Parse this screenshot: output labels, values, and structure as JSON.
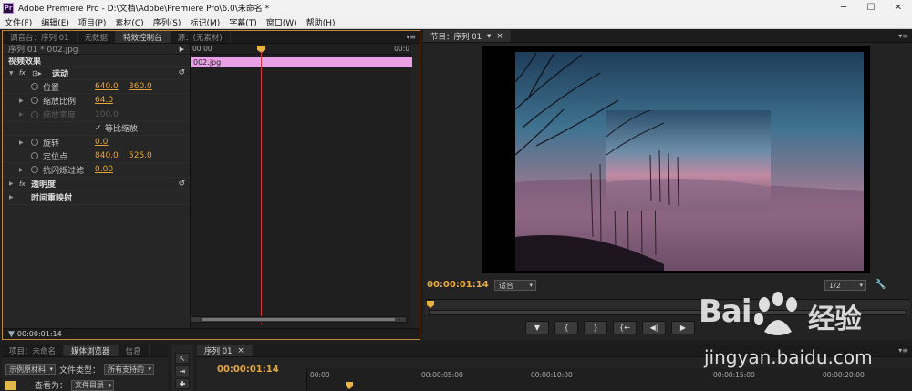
{
  "window": {
    "title": "Adobe Premiere Pro - D:\\文档\\Adobe\\Premiere Pro\\6.0\\未命名 *",
    "logo_text": "Pr"
  },
  "menu": [
    "文件(F)",
    "编辑(E)",
    "项目(P)",
    "素材(C)",
    "序列(S)",
    "标记(M)",
    "字幕(T)",
    "窗口(W)",
    "帮助(H)"
  ],
  "effect_panel": {
    "tabs": [
      "调音台：序列 01",
      "元数据",
      "特效控制台",
      "源：(无素材)"
    ],
    "active_tab": 2,
    "sequence_label": "序列 01 * 002.jpg",
    "video_effects_label": "视频效果",
    "motion_label": "运动",
    "properties": {
      "position": {
        "label": "位置",
        "x": "640.0",
        "y": "360.0"
      },
      "scale": {
        "label": "缩放比例",
        "value": "64.0"
      },
      "scale_width": {
        "label": "缩放宽度",
        "value": "100.0"
      },
      "uniform_scale": {
        "label": "等比缩放",
        "checked": true
      },
      "rotation": {
        "label": "旋转",
        "value": "0.0"
      },
      "anchor": {
        "label": "定位点",
        "x": "840.0",
        "y": "525.0"
      },
      "antiflicker": {
        "label": "抗闪烁过滤",
        "value": "0.00"
      }
    },
    "opacity_label": "透明度",
    "time_remap_label": "时间重映射",
    "ruler": {
      "start": "00:00",
      "end": "00:0"
    },
    "clip_name": "002.jpg",
    "footer_timecode": "00:00:01:14"
  },
  "program_monitor": {
    "tab": "节目：序列 01",
    "timecode": "00:00:01:14",
    "fit": "适合",
    "resolution": "1/2",
    "transport": [
      "▼",
      "{",
      "}",
      "{←",
      "◀|",
      "▶",
      "|▶",
      "→}",
      "⊞",
      "⊟"
    ]
  },
  "project_panel": {
    "tabs": [
      "项目：未命名",
      "媒体浏览器",
      "信息"
    ],
    "active_tab": 1,
    "filter": "示例原材料",
    "file_type_label": "文件类型：",
    "file_type_value": "所有支持的",
    "view_label": "查看为：",
    "view_value": "文件目录"
  },
  "timeline": {
    "tab": "序列 01",
    "timecode": "00:00:01:14",
    "ticks": [
      "00:00",
      "00:00:05:00",
      "00:00:10:00",
      "00:00:15:00",
      "00:00:20:00"
    ]
  },
  "watermark": {
    "brand_left": "Bai",
    "brand_right": "经验",
    "url": "jingyan.baidu.com"
  },
  "colors": {
    "accent": "#e8a93a",
    "clip": "#e9a0e4",
    "playhead": "#d23c3c"
  }
}
